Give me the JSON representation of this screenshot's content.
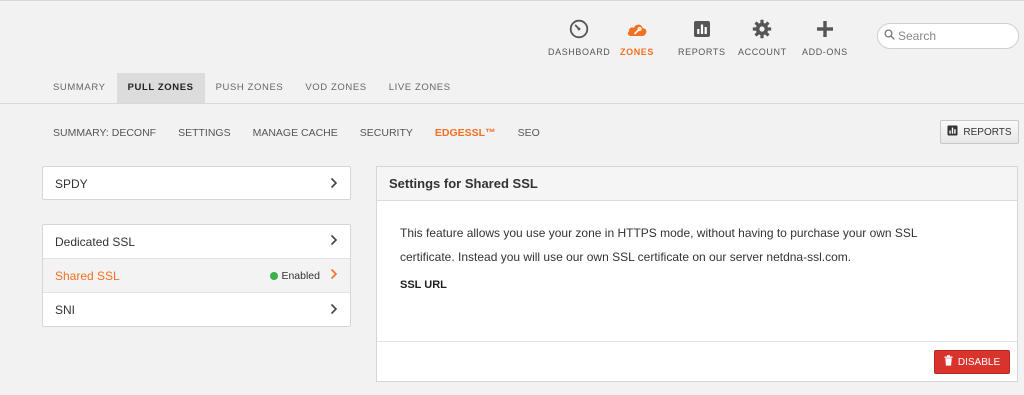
{
  "topnav": {
    "items": [
      {
        "label": "DASHBOARD",
        "icon": "gauge-icon"
      },
      {
        "label": "ZONES",
        "icon": "cloud-wrench-icon"
      },
      {
        "label": "REPORTS",
        "icon": "bar-chart-icon"
      },
      {
        "label": "ACCOUNT",
        "icon": "gear-icon"
      },
      {
        "label": "ADD-ONS",
        "icon": "plus-icon"
      }
    ],
    "active_color": "#f37021"
  },
  "search": {
    "placeholder": "Search"
  },
  "zone_tabs": [
    "SUMMARY",
    "PULL ZONES",
    "PUSH ZONES",
    "VOD ZONES",
    "LIVE ZONES"
  ],
  "sub_nav": [
    "SUMMARY: DECONF",
    "SETTINGS",
    "MANAGE CACHE",
    "SECURITY",
    "EDGESSL™",
    "SEO"
  ],
  "reports_button": "REPORTS",
  "left_panel_top": {
    "items": [
      {
        "label": "SPDY"
      }
    ]
  },
  "left_panel_ssl": {
    "items": [
      {
        "label": "Dedicated SSL"
      },
      {
        "label": "Shared SSL",
        "status": "Enabled"
      },
      {
        "label": "SNI"
      }
    ]
  },
  "card": {
    "title": "Settings for Shared SSL",
    "description": "This feature allows you use your zone in HTTPS mode, without having to purchase your own SSL certificate. Instead you will use our own SSL certificate on our server netdna-ssl.com.",
    "ssl_url_label": "SSL URL",
    "disable_button": "DISABLE"
  },
  "colors": {
    "accent": "#f37021",
    "danger": "#d9342b",
    "enabled": "#3cb04a"
  }
}
